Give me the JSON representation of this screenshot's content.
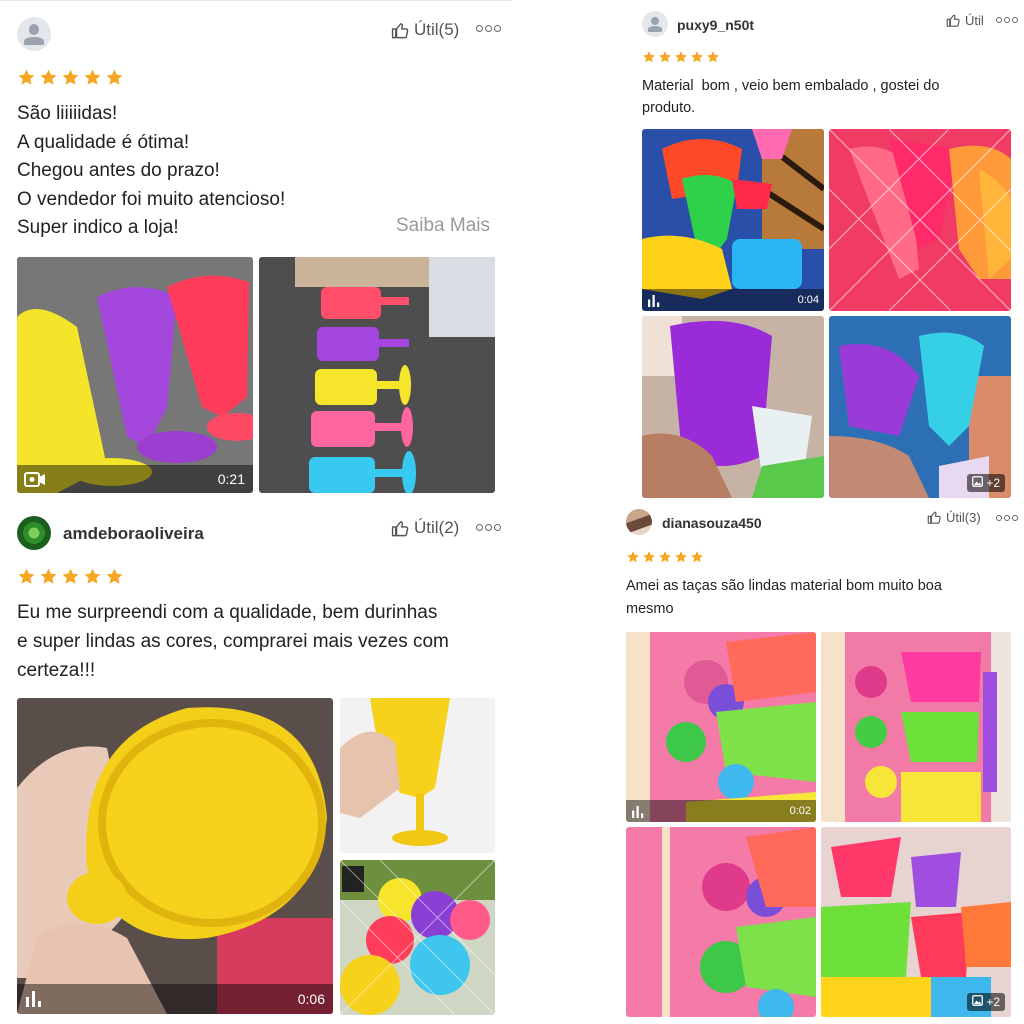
{
  "reviews": [
    {
      "username": "",
      "util_label": "Útil(5)",
      "stars": 5,
      "text_lines": [
        "São liiiiidas!",
        "A qualidade é ótima!",
        "Chegou antes do prazo!",
        "O vendedor foi muito atencioso!",
        "Super indico a loja!"
      ],
      "saiba_mais": "Saiba Mais",
      "media": [
        {
          "kind": "video",
          "icon": "video-camera-icon",
          "duration": "0:21"
        },
        {
          "kind": "image"
        }
      ]
    },
    {
      "username": "amdeboraoliveira",
      "util_label": "Útil(2)",
      "stars": 5,
      "text_lines": [
        "Eu me surpreendi com a qualidade, bem durinhas",
        "e super lindas as cores, comprarei mais vezes com",
        "certeza!!!"
      ],
      "media": [
        {
          "kind": "video",
          "icon": "audio-bars-icon",
          "duration": "0:06"
        },
        {
          "kind": "image"
        },
        {
          "kind": "image"
        }
      ]
    },
    {
      "username": "puxy9_n50t",
      "util_label": "Útil",
      "stars": 5,
      "text_lines": [
        "Material  bom , veio bem embalado , gostei do",
        "produto."
      ],
      "media": [
        {
          "kind": "video",
          "icon": "audio-bars-icon",
          "duration": "0:04"
        },
        {
          "kind": "image"
        },
        {
          "kind": "image"
        },
        {
          "kind": "image",
          "more_count": "+2"
        }
      ]
    },
    {
      "username": "dianasouza450",
      "util_label": "Útil(3)",
      "stars": 5,
      "text_lines": [
        "Amei as taças são lindas material bom muito boa",
        "mesmo"
      ],
      "media": [
        {
          "kind": "video",
          "icon": "audio-bars-icon",
          "duration": "0:02"
        },
        {
          "kind": "image"
        },
        {
          "kind": "image"
        },
        {
          "kind": "image",
          "more_count": "+2"
        }
      ]
    }
  ],
  "colors": {
    "star": "#f5a623",
    "muted": "#9a9a9a",
    "text": "#222222"
  }
}
